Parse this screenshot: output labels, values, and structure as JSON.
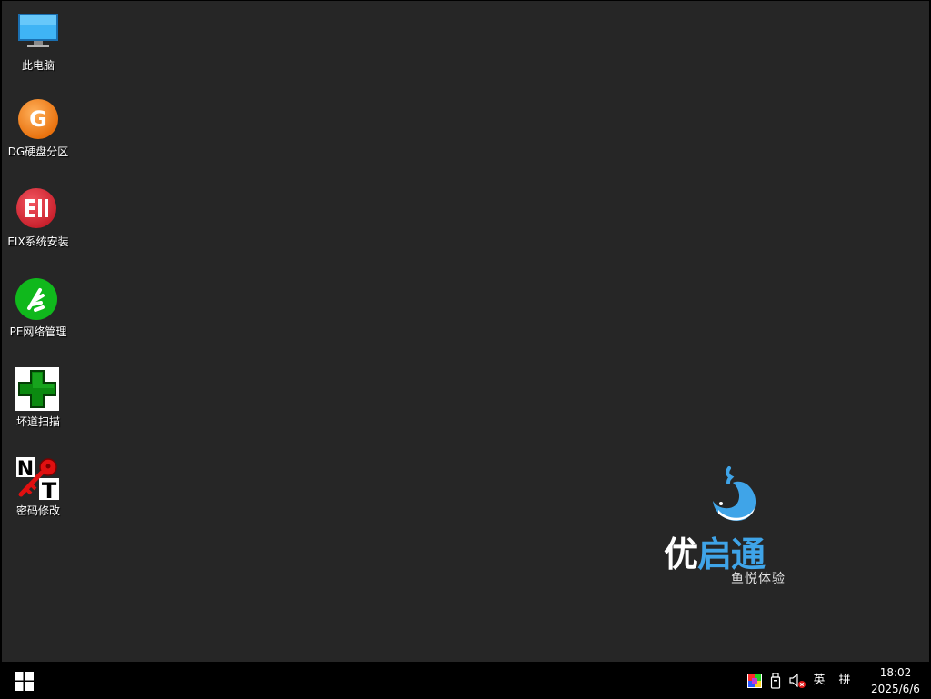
{
  "desktop": {
    "icons": [
      {
        "id": "this-pc",
        "label": "此电脑",
        "icon": "monitor-icon"
      },
      {
        "id": "dg-partition",
        "label": "DG硬盘分区",
        "icon": "diskgenius-icon"
      },
      {
        "id": "eix-install",
        "label": "EIX系统安装",
        "icon": "eix-install-icon"
      },
      {
        "id": "pe-network",
        "label": "PE网络管理",
        "icon": "network-manager-icon"
      },
      {
        "id": "bad-sector-scan",
        "label": "坏道扫描",
        "icon": "green-cross-icon"
      },
      {
        "id": "password-change",
        "label": "密码修改",
        "icon": "nt-key-icon"
      }
    ],
    "logo": {
      "title_part1": "优",
      "title_part2": "启通",
      "subtitle": "鱼悦体验",
      "accent_color": "#3fa4e8"
    },
    "background_color": "#262626"
  },
  "taskbar": {
    "start_icon": "windows-logo-icon",
    "tray": {
      "color_icon": "color-squares-icon",
      "usb_icon": "usb-drive-icon",
      "volume_icon": "volume-muted-icon",
      "ime_lang": "英",
      "ime_mode": "拼"
    },
    "clock": {
      "time": "18:02",
      "date": "2025/6/6"
    }
  }
}
